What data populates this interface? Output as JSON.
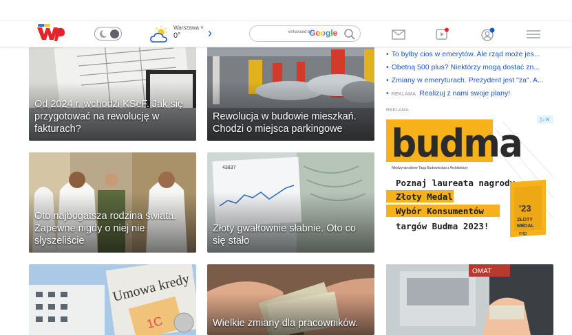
{
  "header": {
    "weather_city": "Warszawa",
    "weather_temp": "0°",
    "search_enhanced": "enhanced by",
    "search_google": "Google",
    "brand_color": "#e4232a",
    "accent_color": "#1a57c9"
  },
  "tiles": [
    {
      "caption": "Od 2024 r. wchodzi KSeF. Jak się przygotować na rewolucję w fakturach?"
    },
    {
      "caption": "Rewolucja w budowie mieszkań. Chodzi o miejsca parkingowe"
    },
    {
      "caption": "Oto najbogatsza rodzina świata. Zapewne nigdy o niej nie słyszeliście"
    },
    {
      "caption": "Złoty gwałtownie słabnie. Oto co się stało"
    },
    {
      "caption": ""
    },
    {
      "caption": "Wielkie zmiany dla pracowników."
    },
    {
      "caption": ""
    }
  ],
  "news": [
    "To byłby cios w emerytów. Ale rząd może jes...",
    "Obetną 500 plus? Niektórzy mogą dostać zn...",
    "Zmiany w emeryturach. Prezydent jest \"za\". A..."
  ],
  "sponsored": {
    "tag": "REKLAMA",
    "text": "Realizuj z nami swoje plany!"
  },
  "ad": {
    "label": "REKLAMA",
    "brand": "budma",
    "subtitle": "Międzynarodowe Targi Budownictwa i Architektury",
    "line1": "Poznaj laureata nagrody",
    "line2": "Złoty Medal",
    "line3": "Wybór Konsumentów",
    "line4": "targów Budma 2023!",
    "badge_year": "'23",
    "badge_line1": "ZŁOTY",
    "badge_line2": "MEDAL",
    "badge_line3": "mtp",
    "close": "▷✕"
  },
  "tile3_chart_label": "43837",
  "tile4_sign": "Umowa kredy",
  "tile4_note": "1C",
  "tile7_sign": "OMAT"
}
